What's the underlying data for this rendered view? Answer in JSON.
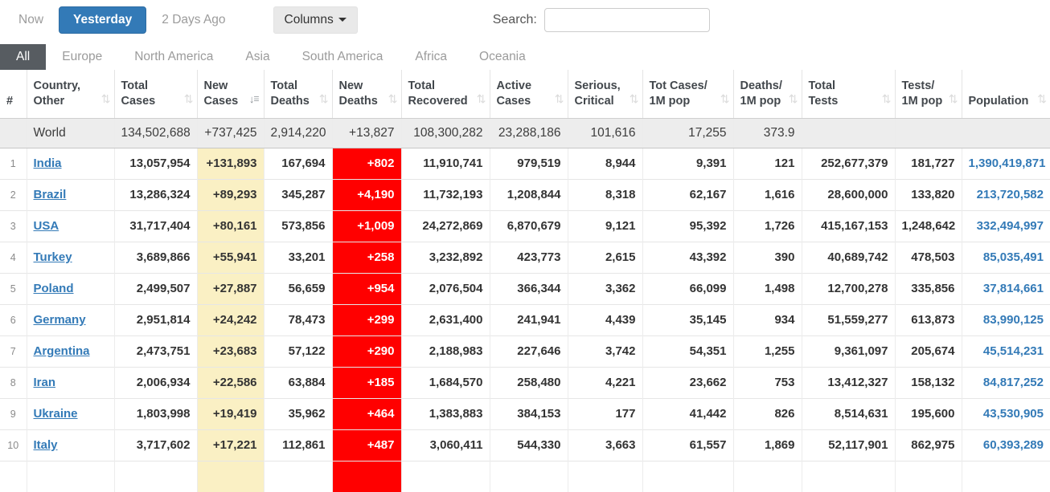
{
  "toolbar": {
    "now_label": "Now",
    "yesterday_label": "Yesterday",
    "two_days_ago_label": "2 Days Ago",
    "columns_label": "Columns",
    "search_label": "Search:",
    "search_value": ""
  },
  "tabs": {
    "active": "All",
    "items": [
      "All",
      "Europe",
      "North America",
      "Asia",
      "South America",
      "Africa",
      "Oceania"
    ]
  },
  "icons": {
    "sort": "⇅",
    "sort_desc_arrow": "↓",
    "sort_desc_bars": "☰",
    "caret_down": "▼"
  },
  "colors": {
    "accent_blue": "#337ab7",
    "new_cases_yellow": "#FAF0C4",
    "new_deaths_red": "#FF0000",
    "active_tab_gray": "#575C61",
    "world_row_gray": "#EDEDED"
  },
  "table": {
    "columns": [
      {
        "key": "rank",
        "l1": "",
        "l2": "#",
        "sortable": false
      },
      {
        "key": "country",
        "l1": "Country,",
        "l2": "Other",
        "sortable": true
      },
      {
        "key": "total_cases",
        "l1": "Total",
        "l2": "Cases",
        "sortable": true
      },
      {
        "key": "new_cases",
        "l1": "New",
        "l2": "Cases",
        "sortable": true,
        "sorted": "desc"
      },
      {
        "key": "total_deaths",
        "l1": "Total",
        "l2": "Deaths",
        "sortable": true
      },
      {
        "key": "new_deaths",
        "l1": "New",
        "l2": "Deaths",
        "sortable": true
      },
      {
        "key": "total_recovered",
        "l1": "Total",
        "l2": "Recovered",
        "sortable": true
      },
      {
        "key": "active_cases",
        "l1": "Active",
        "l2": "Cases",
        "sortable": true
      },
      {
        "key": "serious_critical",
        "l1": "Serious,",
        "l2": "Critical",
        "sortable": true
      },
      {
        "key": "tot_cases_1m",
        "l1": "Tot Cases/",
        "l2": "1M pop",
        "sortable": true
      },
      {
        "key": "deaths_1m",
        "l1": "Deaths/",
        "l2": "1M pop",
        "sortable": true
      },
      {
        "key": "total_tests",
        "l1": "Total",
        "l2": "Tests",
        "sortable": true
      },
      {
        "key": "tests_1m",
        "l1": "Tests/",
        "l2": "1M pop",
        "sortable": true
      },
      {
        "key": "population",
        "l1": "",
        "l2": "Population",
        "sortable": true
      }
    ],
    "world_row": {
      "rank": "",
      "country": "World",
      "total_cases": "134,502,688",
      "new_cases": "+737,425",
      "total_deaths": "2,914,220",
      "new_deaths": "+13,827",
      "total_recovered": "108,300,282",
      "active_cases": "23,288,186",
      "serious_critical": "101,616",
      "tot_cases_1m": "17,255",
      "deaths_1m": "373.9",
      "total_tests": "",
      "tests_1m": "",
      "population": ""
    },
    "rows": [
      {
        "rank": "1",
        "country": "India",
        "total_cases": "13,057,954",
        "new_cases": "+131,893",
        "total_deaths": "167,694",
        "new_deaths": "+802",
        "total_recovered": "11,910,741",
        "active_cases": "979,519",
        "serious_critical": "8,944",
        "tot_cases_1m": "9,391",
        "deaths_1m": "121",
        "total_tests": "252,677,379",
        "tests_1m": "181,727",
        "population": "1,390,419,871"
      },
      {
        "rank": "2",
        "country": "Brazil",
        "total_cases": "13,286,324",
        "new_cases": "+89,293",
        "total_deaths": "345,287",
        "new_deaths": "+4,190",
        "total_recovered": "11,732,193",
        "active_cases": "1,208,844",
        "serious_critical": "8,318",
        "tot_cases_1m": "62,167",
        "deaths_1m": "1,616",
        "total_tests": "28,600,000",
        "tests_1m": "133,820",
        "population": "213,720,582"
      },
      {
        "rank": "3",
        "country": "USA",
        "total_cases": "31,717,404",
        "new_cases": "+80,161",
        "total_deaths": "573,856",
        "new_deaths": "+1,009",
        "total_recovered": "24,272,869",
        "active_cases": "6,870,679",
        "serious_critical": "9,121",
        "tot_cases_1m": "95,392",
        "deaths_1m": "1,726",
        "total_tests": "415,167,153",
        "tests_1m": "1,248,642",
        "population": "332,494,997"
      },
      {
        "rank": "4",
        "country": "Turkey",
        "total_cases": "3,689,866",
        "new_cases": "+55,941",
        "total_deaths": "33,201",
        "new_deaths": "+258",
        "total_recovered": "3,232,892",
        "active_cases": "423,773",
        "serious_critical": "2,615",
        "tot_cases_1m": "43,392",
        "deaths_1m": "390",
        "total_tests": "40,689,742",
        "tests_1m": "478,503",
        "population": "85,035,491"
      },
      {
        "rank": "5",
        "country": "Poland",
        "total_cases": "2,499,507",
        "new_cases": "+27,887",
        "total_deaths": "56,659",
        "new_deaths": "+954",
        "total_recovered": "2,076,504",
        "active_cases": "366,344",
        "serious_critical": "3,362",
        "tot_cases_1m": "66,099",
        "deaths_1m": "1,498",
        "total_tests": "12,700,278",
        "tests_1m": "335,856",
        "population": "37,814,661"
      },
      {
        "rank": "6",
        "country": "Germany",
        "total_cases": "2,951,814",
        "new_cases": "+24,242",
        "total_deaths": "78,473",
        "new_deaths": "+299",
        "total_recovered": "2,631,400",
        "active_cases": "241,941",
        "serious_critical": "4,439",
        "tot_cases_1m": "35,145",
        "deaths_1m": "934",
        "total_tests": "51,559,277",
        "tests_1m": "613,873",
        "population": "83,990,125"
      },
      {
        "rank": "7",
        "country": "Argentina",
        "total_cases": "2,473,751",
        "new_cases": "+23,683",
        "total_deaths": "57,122",
        "new_deaths": "+290",
        "total_recovered": "2,188,983",
        "active_cases": "227,646",
        "serious_critical": "3,742",
        "tot_cases_1m": "54,351",
        "deaths_1m": "1,255",
        "total_tests": "9,361,097",
        "tests_1m": "205,674",
        "population": "45,514,231"
      },
      {
        "rank": "8",
        "country": "Iran",
        "total_cases": "2,006,934",
        "new_cases": "+22,586",
        "total_deaths": "63,884",
        "new_deaths": "+185",
        "total_recovered": "1,684,570",
        "active_cases": "258,480",
        "serious_critical": "4,221",
        "tot_cases_1m": "23,662",
        "deaths_1m": "753",
        "total_tests": "13,412,327",
        "tests_1m": "158,132",
        "population": "84,817,252"
      },
      {
        "rank": "9",
        "country": "Ukraine",
        "total_cases": "1,803,998",
        "new_cases": "+19,419",
        "total_deaths": "35,962",
        "new_deaths": "+464",
        "total_recovered": "1,383,883",
        "active_cases": "384,153",
        "serious_critical": "177",
        "tot_cases_1m": "41,442",
        "deaths_1m": "826",
        "total_tests": "8,514,631",
        "tests_1m": "195,600",
        "population": "43,530,905"
      },
      {
        "rank": "10",
        "country": "Italy",
        "total_cases": "3,717,602",
        "new_cases": "+17,221",
        "total_deaths": "112,861",
        "new_deaths": "+487",
        "total_recovered": "3,060,411",
        "active_cases": "544,330",
        "serious_critical": "3,663",
        "tot_cases_1m": "61,557",
        "deaths_1m": "1,869",
        "total_tests": "52,117,901",
        "tests_1m": "862,975",
        "population": "60,393,289"
      },
      {
        "rank": "",
        "country": "",
        "total_cases": "",
        "new_cases": "",
        "total_deaths": "",
        "new_deaths": "",
        "total_recovered": "",
        "active_cases": "",
        "serious_critical": "",
        "tot_cases_1m": "",
        "deaths_1m": "",
        "total_tests": "",
        "tests_1m": "",
        "population": ""
      }
    ]
  }
}
